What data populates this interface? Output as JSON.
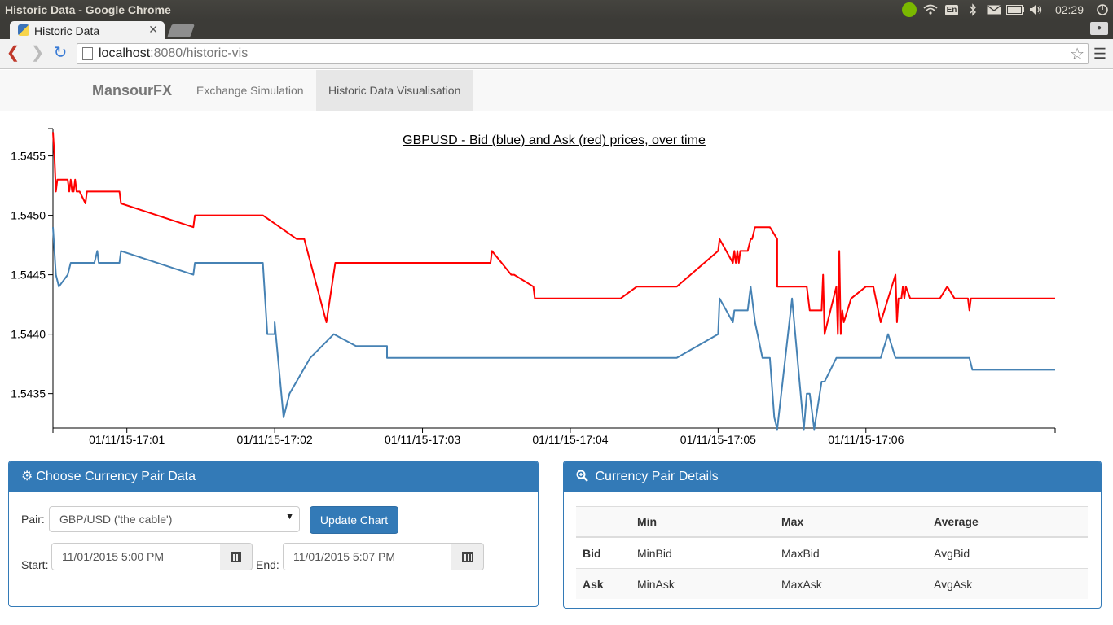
{
  "os": {
    "window_title": "Historic Data - Google Chrome",
    "keyboard_layout": "En",
    "clock": "02:29",
    "tray_icons": [
      "spotify-icon",
      "wifi-icon",
      "keyboard-icon",
      "bluetooth-icon",
      "mail-icon",
      "battery-icon",
      "volume-icon",
      "settings-icon"
    ]
  },
  "browser": {
    "tab_title": "Historic Data",
    "url_host": "localhost",
    "url_rest": ":8080/historic-vis"
  },
  "navbar": {
    "brand": "MansourFX",
    "links": [
      "Exchange Simulation",
      "Historic Data Visualisation"
    ],
    "active_index": 1
  },
  "chart_data": {
    "type": "line",
    "title": "GBPUSD - Bid (blue) and Ask (red) prices, over time",
    "xlabel": "",
    "ylabel": "",
    "x_tick_labels": [
      "01/11/15-17:01",
      "01/11/15-17:02",
      "01/11/15-17:03",
      "01/11/15-17:04",
      "01/11/15-17:05",
      "01/11/15-17:06"
    ],
    "x_ticks_minutes": [
      1,
      2,
      3,
      4,
      5,
      6
    ],
    "xlim_minutes": [
      0.5,
      7.28
    ],
    "y_tick_labels": [
      "1.5435",
      "1.5440",
      "1.5445",
      "1.5450",
      "1.5455"
    ],
    "ylim": [
      1.54321,
      1.54573
    ],
    "grid": false,
    "series": [
      {
        "name": "Ask",
        "color": "#ff0000",
        "x_minutes": [
          0.5,
          0.51,
          0.52,
          0.53,
          0.6,
          0.61,
          0.62,
          0.63,
          0.64,
          0.65,
          0.66,
          0.67,
          0.68,
          0.72,
          0.73,
          0.74,
          0.78,
          0.79,
          0.8,
          0.81,
          0.95,
          0.96,
          1.45,
          1.46,
          1.47,
          1.7,
          1.71,
          1.72,
          1.75,
          1.76,
          1.77,
          1.91,
          1.92,
          2.15,
          2.2,
          2.35,
          2.41,
          2.42,
          2.43,
          2.5,
          2.55,
          3.46,
          3.47,
          3.6,
          3.61,
          3.62,
          3.75,
          3.76,
          3.77,
          3.8,
          3.81,
          3.82,
          4.0,
          4.3,
          4.31,
          4.31,
          4.32,
          4.33,
          4.34,
          4.45,
          4.46,
          4.47,
          4.5,
          4.52,
          4.54,
          4.6,
          4.61,
          4.62,
          4.7,
          4.71,
          4.72,
          5.0,
          5.01,
          5.1,
          5.11,
          5.12,
          5.13,
          5.14,
          5.15,
          5.2,
          5.22,
          5.23,
          5.25,
          5.3,
          5.35,
          5.4,
          5.4,
          5.5,
          5.6,
          5.62,
          5.7,
          5.71,
          5.72,
          5.8,
          5.81,
          5.82,
          5.83,
          5.84,
          5.85,
          5.9,
          6.0,
          6.05,
          6.1,
          6.2,
          6.21,
          6.22,
          6.23,
          6.24,
          6.25,
          6.26,
          6.27,
          6.3,
          6.5,
          6.55,
          6.6,
          6.61,
          6.62,
          6.63,
          6.64,
          6.65,
          6.66,
          6.67,
          6.68,
          6.69,
          6.7,
          6.71,
          6.72,
          7.28
        ],
        "values": [
          1.5457,
          1.5455,
          1.5452,
          1.5453,
          1.5453,
          1.5452,
          1.5453,
          1.5452,
          1.5452,
          1.5453,
          1.5452,
          1.5452,
          1.5452,
          1.5451,
          1.5452,
          1.5452,
          1.5452,
          1.5452,
          1.5452,
          1.5452,
          1.5452,
          1.5451,
          1.5449,
          1.545,
          1.545,
          1.545,
          1.545,
          1.545,
          1.545,
          1.545,
          1.545,
          1.545,
          1.545,
          1.5448,
          1.5448,
          1.5441,
          1.5446,
          1.5446,
          1.5446,
          1.5446,
          1.5446,
          1.5446,
          1.5447,
          1.5445,
          1.5445,
          1.5445,
          1.5444,
          1.5443,
          1.5443,
          1.5443,
          1.5443,
          1.5443,
          1.5443,
          1.5443,
          1.5443,
          1.5443,
          1.5443,
          1.5443,
          1.5443,
          1.5444,
          1.5444,
          1.5444,
          1.5444,
          1.5444,
          1.5444,
          1.5444,
          1.5444,
          1.5444,
          1.5444,
          1.5444,
          1.5444,
          1.5447,
          1.5448,
          1.5446,
          1.5447,
          1.5446,
          1.5447,
          1.5446,
          1.5447,
          1.5447,
          1.5448,
          1.5448,
          1.5449,
          1.5449,
          1.5449,
          1.5448,
          1.5444,
          1.5444,
          1.5444,
          1.5442,
          1.5442,
          1.5445,
          1.544,
          1.5444,
          1.544,
          1.5447,
          1.544,
          1.5442,
          1.5441,
          1.5443,
          1.5444,
          1.5444,
          1.5441,
          1.5445,
          1.5441,
          1.5443,
          1.5443,
          1.5443,
          1.5444,
          1.5443,
          1.5444,
          1.5443,
          1.5443,
          1.5444,
          1.5443,
          1.5443,
          1.5443,
          1.5443,
          1.5443,
          1.5443,
          1.5443,
          1.5443,
          1.5443,
          1.5443,
          1.5442,
          1.5443,
          1.5443,
          1.5443
        ]
      },
      {
        "name": "Bid",
        "color": "#4682b4",
        "x_minutes": [
          0.5,
          0.51,
          0.52,
          0.54,
          0.6,
          0.62,
          0.65,
          0.68,
          0.72,
          0.75,
          0.78,
          0.8,
          0.81,
          0.95,
          0.96,
          1.45,
          1.46,
          1.47,
          1.5,
          1.7,
          1.91,
          1.92,
          1.95,
          2.0,
          2.0,
          2.06,
          2.1,
          2.24,
          2.4,
          2.55,
          2.76,
          2.76,
          2.76,
          2.88,
          2.9,
          3.35,
          3.36,
          3.46,
          3.47,
          3.6,
          3.61,
          3.62,
          4.0,
          4.3,
          4.31,
          4.32,
          4.4,
          4.47,
          4.5,
          4.55,
          4.6,
          4.61,
          4.62,
          4.7,
          4.71,
          4.72,
          5.0,
          5.01,
          5.1,
          5.11,
          5.15,
          5.2,
          5.22,
          5.24,
          5.25,
          5.3,
          5.35,
          5.38,
          5.4,
          5.5,
          5.58,
          5.6,
          5.62,
          5.64,
          5.65,
          5.7,
          5.72,
          5.8,
          5.85,
          5.9,
          5.96,
          6.0,
          6.05,
          6.1,
          6.15,
          6.2,
          6.3,
          6.35,
          6.4,
          6.5,
          6.55,
          6.6,
          6.7,
          6.72,
          6.75,
          6.8,
          6.85,
          6.9,
          6.95,
          7.0,
          7.05,
          7.1,
          7.15,
          7.2,
          7.28
        ],
        "values": [
          1.5449,
          1.5447,
          1.5445,
          1.5444,
          1.5445,
          1.5446,
          1.5446,
          1.5446,
          1.5446,
          1.5446,
          1.5446,
          1.5447,
          1.5446,
          1.5446,
          1.5447,
          1.5445,
          1.5446,
          1.5446,
          1.5446,
          1.5446,
          1.5446,
          1.5446,
          1.544,
          1.544,
          1.5441,
          1.5433,
          1.5435,
          1.5438,
          1.544,
          1.5439,
          1.5439,
          1.5438,
          1.5438,
          1.5438,
          1.5438,
          1.5438,
          1.5438,
          1.5438,
          1.5438,
          1.5438,
          1.5438,
          1.5438,
          1.5438,
          1.5438,
          1.5438,
          1.5438,
          1.5438,
          1.5438,
          1.5438,
          1.5438,
          1.5438,
          1.5438,
          1.5438,
          1.5438,
          1.5438,
          1.5438,
          1.544,
          1.5443,
          1.5441,
          1.5442,
          1.5442,
          1.5442,
          1.5444,
          1.5442,
          1.5441,
          1.5438,
          1.5438,
          1.5433,
          1.5432,
          1.5443,
          1.5432,
          1.5435,
          1.5435,
          1.5433,
          1.5432,
          1.5436,
          1.5436,
          1.5438,
          1.5438,
          1.5438,
          1.5438,
          1.5438,
          1.5438,
          1.5438,
          1.544,
          1.5438,
          1.5438,
          1.5438,
          1.5438,
          1.5438,
          1.5438,
          1.5438,
          1.5438,
          1.5437,
          1.5437,
          1.5437,
          1.5437,
          1.5437,
          1.5437,
          1.5437,
          1.5437,
          1.5437,
          1.5437,
          1.5437,
          1.5437
        ]
      }
    ]
  },
  "choose_panel": {
    "title": "Choose Currency Pair Data",
    "pair_label": "Pair:",
    "pair_value": "GBP/USD ('the cable')",
    "update_button": "Update Chart",
    "start_label": "Start:",
    "start_value": "11/01/2015 5:00 PM",
    "end_label": "End:",
    "end_value": "11/01/2015 5:07 PM"
  },
  "details_panel": {
    "title": "Currency Pair Details",
    "headers": [
      "",
      "Min",
      "Max",
      "Average"
    ],
    "rows": [
      [
        "Bid",
        "MinBid",
        "MaxBid",
        "AvgBid"
      ],
      [
        "Ask",
        "MinAsk",
        "MaxAsk",
        "AvgAsk"
      ]
    ]
  }
}
